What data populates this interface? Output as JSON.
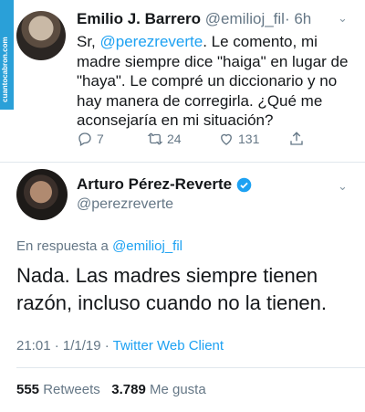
{
  "tweet1": {
    "author_name": "Emilio J. Barrero",
    "author_handle": "@emilioj_fil",
    "time": "· 6h",
    "text_prefix": "Sr, ",
    "mention": "@perezreverte",
    "text_body": ". Le comento, mi madre siempre dice \"haiga\" en lugar de \"haya\". Le compré un diccionario y no hay manera de corregirla. ¿Qué me aconsejaría en mi situación?",
    "replies": "7",
    "retweets": "24",
    "likes": "131"
  },
  "tweet2": {
    "author_name": "Arturo Pérez-Reverte",
    "author_handle": "@perezreverte",
    "reply_prefix": "En respuesta a ",
    "reply_handle": "@emilioj_fil",
    "text": "Nada. Las madres siempre tienen razón, incluso cuando no la tienen.",
    "time": "21:01 · 1/1/19 · ",
    "client": "Twitter Web Client",
    "retweets_count": "555",
    "retweets_label": "Retweets",
    "likes_count": "3.789",
    "likes_label": "Me gusta"
  },
  "watermark": "cuantocabron.com",
  "colors": {
    "accent": "#1da1f2",
    "secondary_text": "#657786",
    "divider": "#e1e8ed"
  }
}
